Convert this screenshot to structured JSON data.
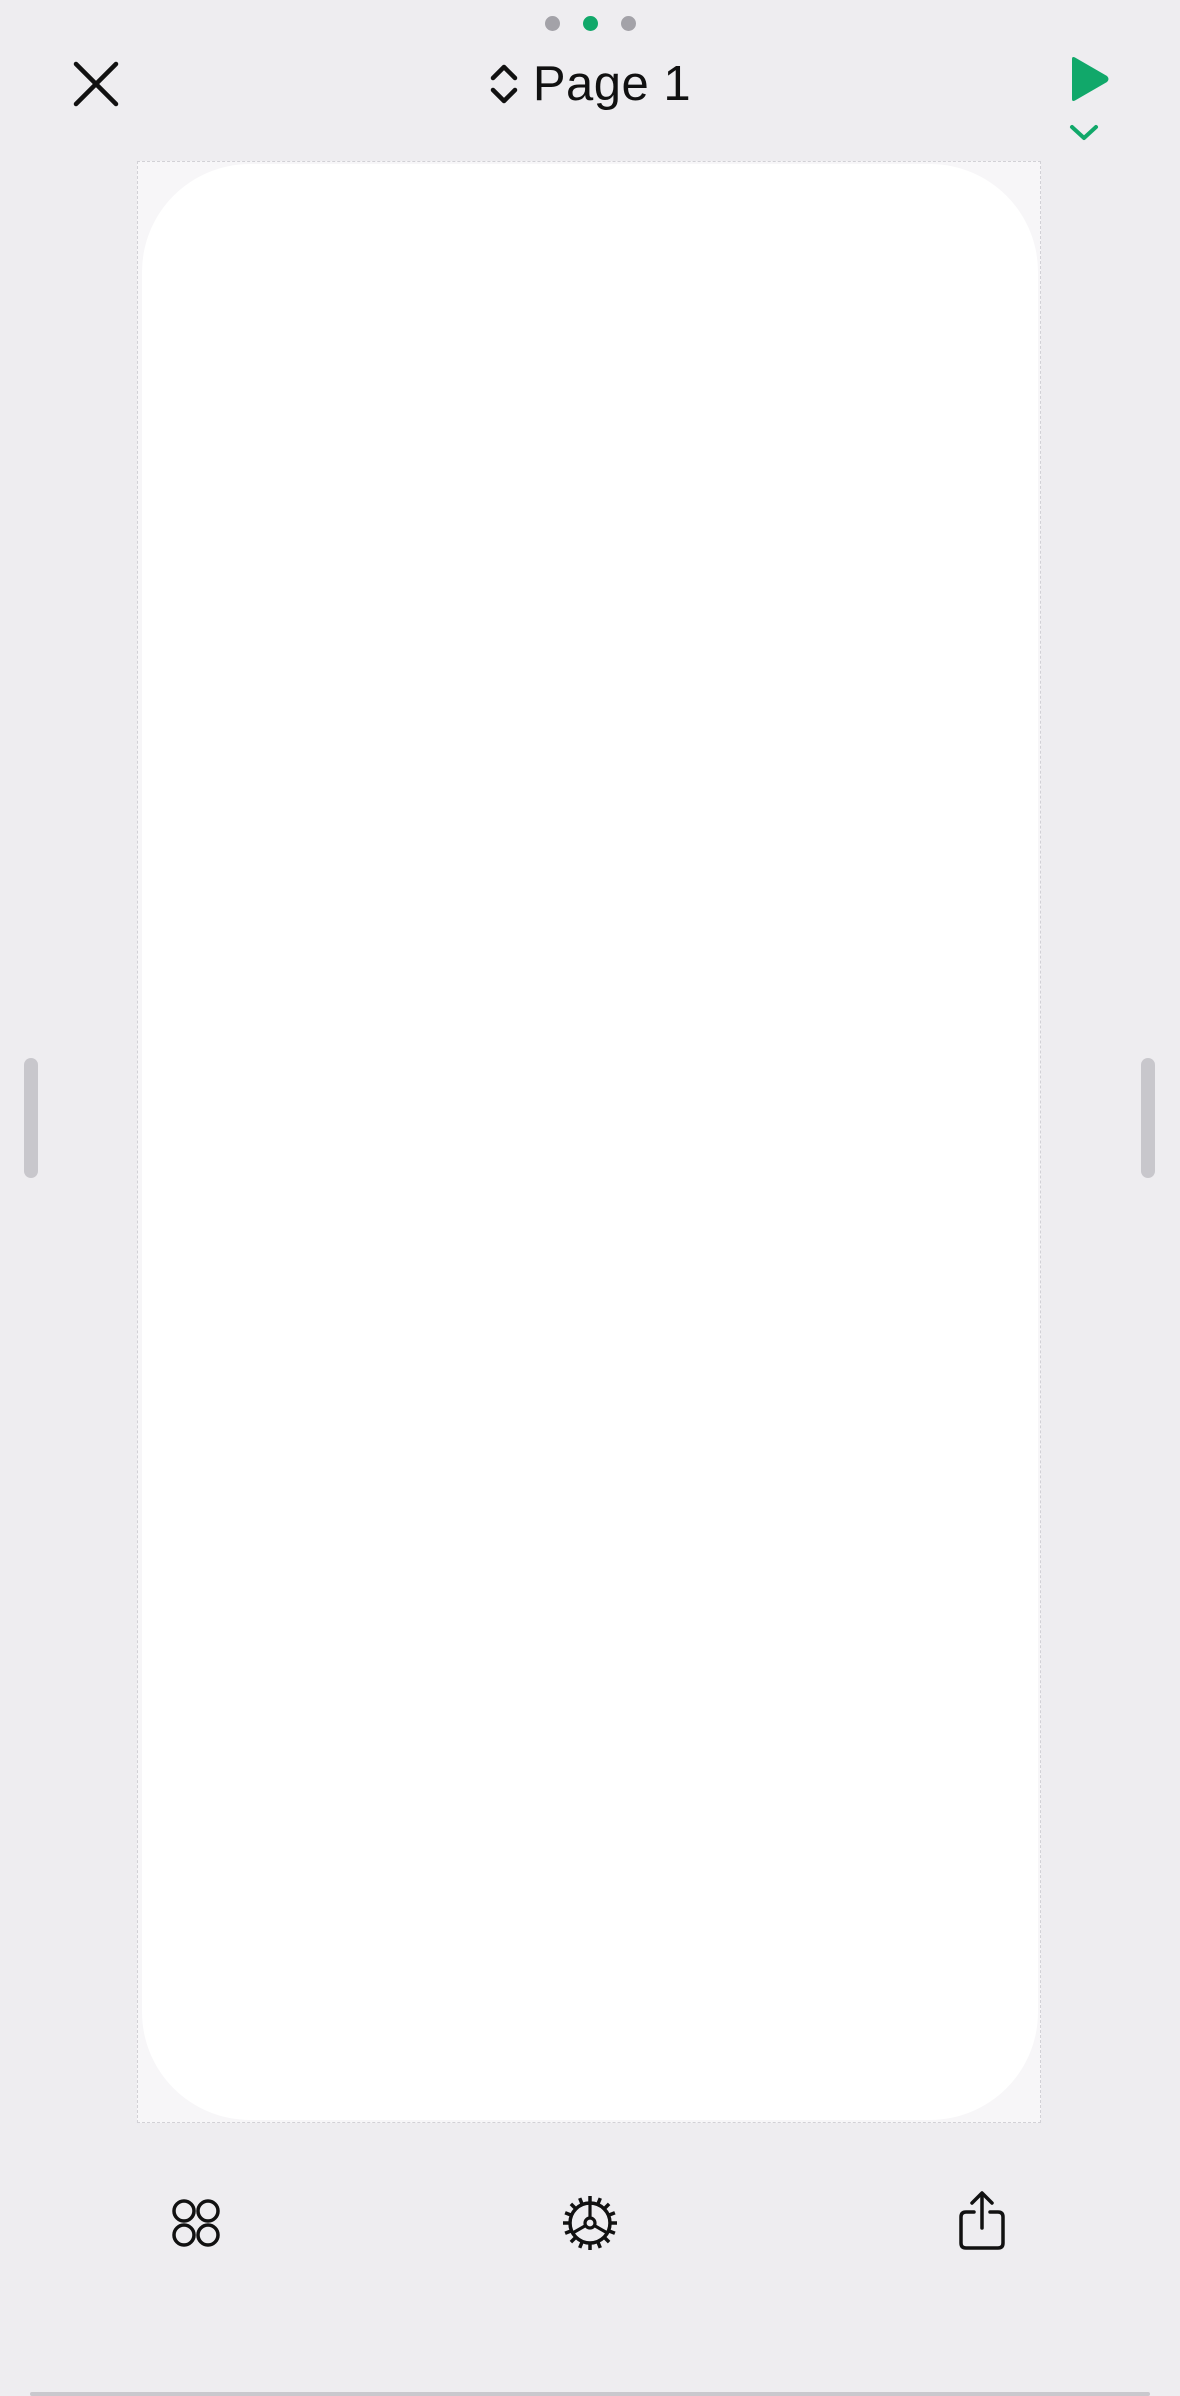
{
  "header": {
    "page_indicator": {
      "count": 3,
      "active_index": 1
    },
    "page_title": "Page 1",
    "icons": {
      "close": "close-icon",
      "page_switcher": "chevron-up-down-icon",
      "play": "play-icon",
      "play_menu": "chevron-down-icon"
    }
  },
  "canvas": {
    "screen_count": 1
  },
  "toolbar": {
    "icons": {
      "left": "components-grid-icon",
      "center": "gear-icon",
      "right": "share-icon"
    }
  },
  "colors": {
    "background": "#eeedf0",
    "accent": "#11a86a",
    "inactive_dot": "#a3a2a8",
    "icon": "#111111",
    "canvas": "#ffffff"
  }
}
